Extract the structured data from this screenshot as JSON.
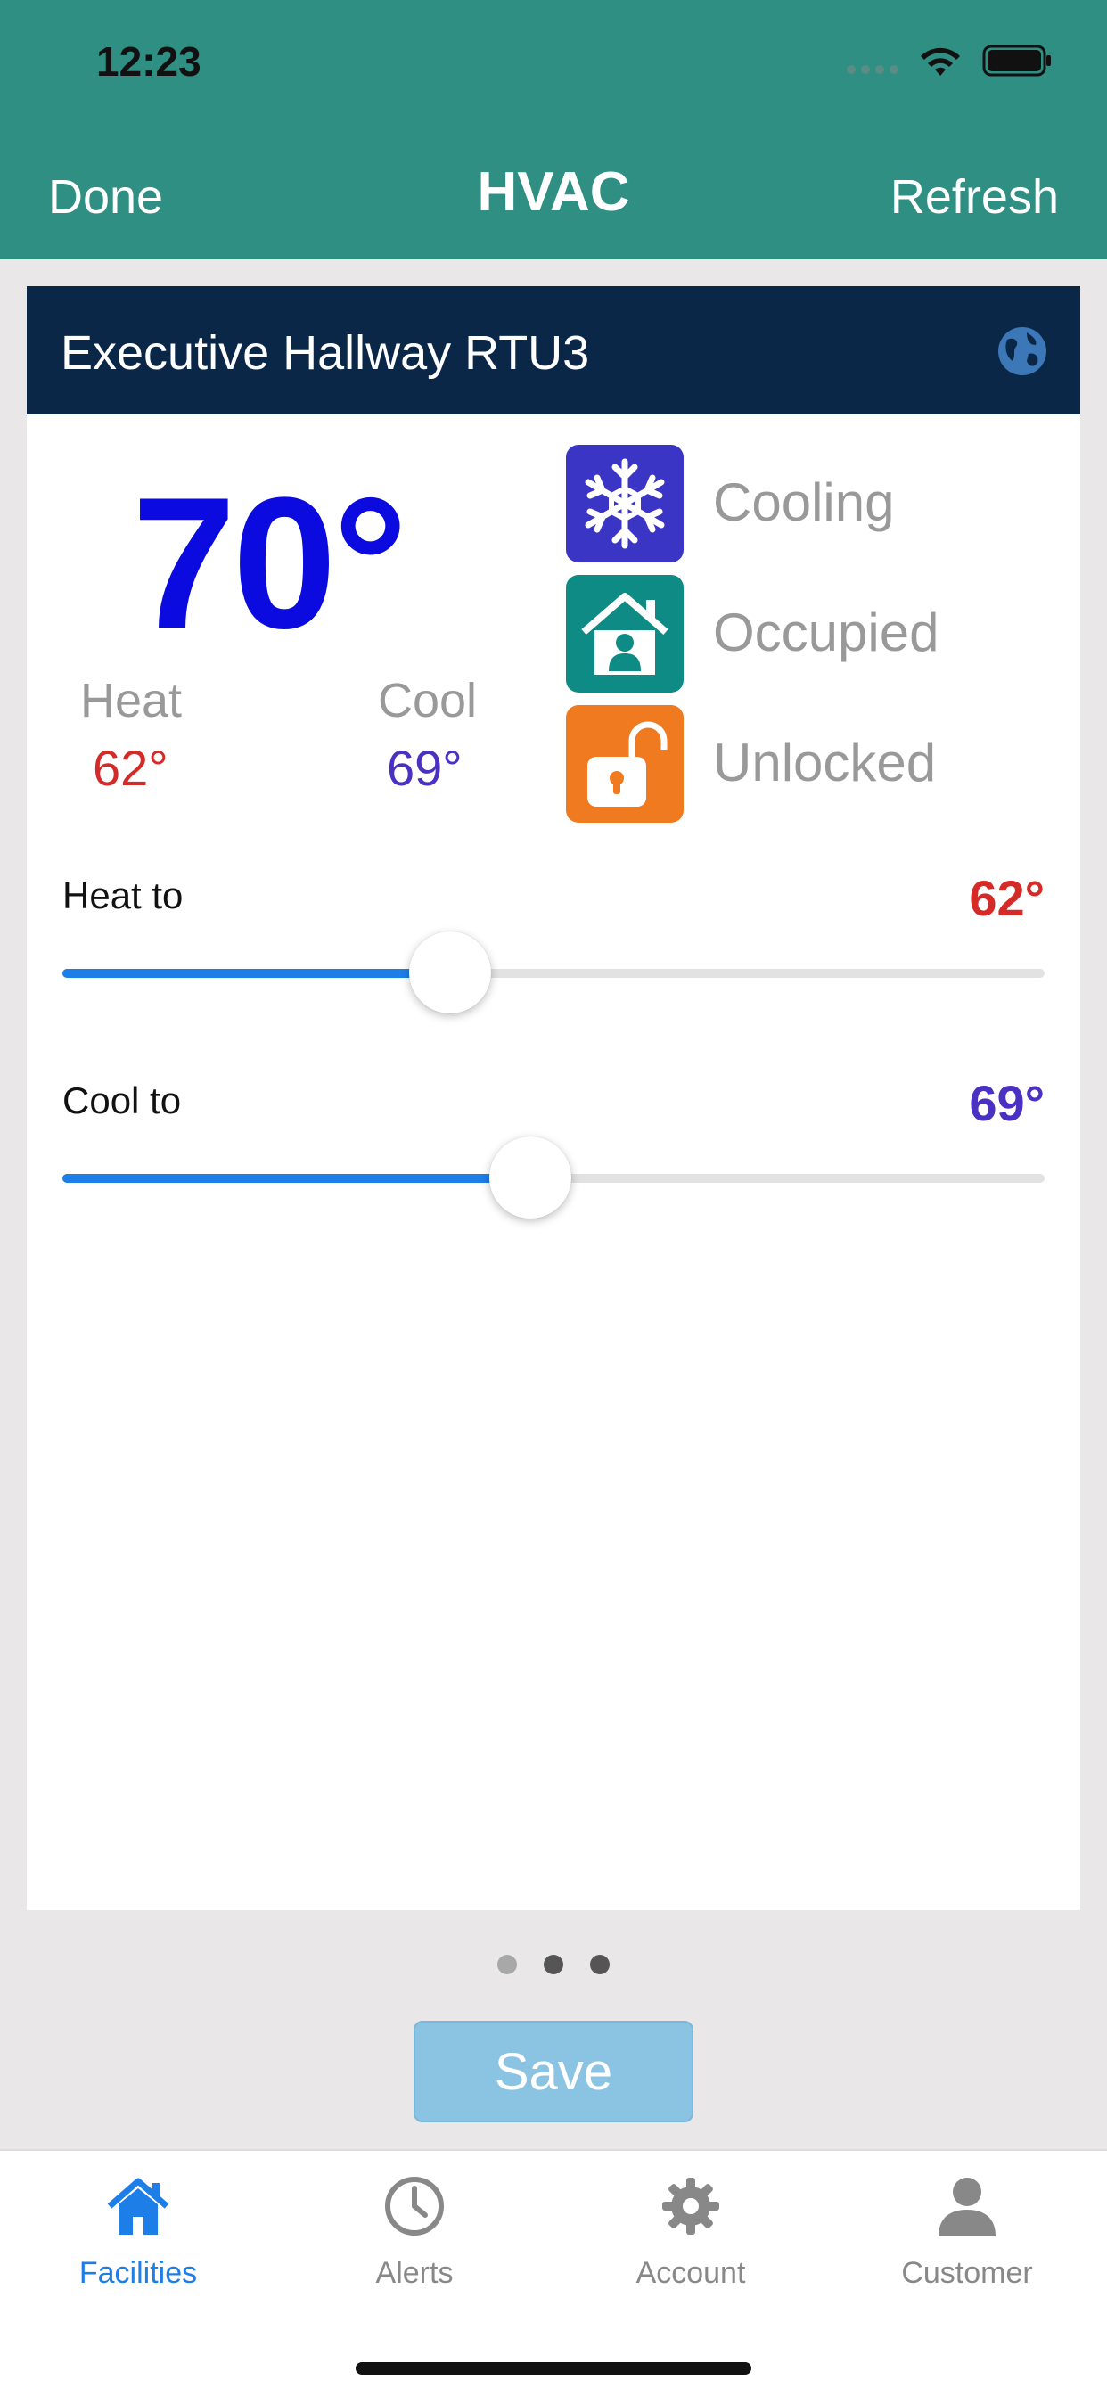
{
  "status_bar": {
    "time": "12:23"
  },
  "nav": {
    "left": "Done",
    "title": "HVAC",
    "right": "Refresh"
  },
  "card": {
    "title": "Executive Hallway RTU3",
    "current_temp": "70°",
    "heat_label": "Heat",
    "heat_value": "62°",
    "cool_label": "Cool",
    "cool_value": "69°",
    "statuses": [
      {
        "label": "Cooling",
        "icon": "snowflake-icon",
        "color": "#3b35c6"
      },
      {
        "label": "Occupied",
        "icon": "house-person-icon",
        "color": "#0e8b84"
      },
      {
        "label": "Unlocked",
        "icon": "unlocked-padlock-icon",
        "color": "#f07a20"
      }
    ],
    "heat_slider": {
      "label": "Heat to",
      "value": "62°",
      "fill_fraction": 0.395,
      "color": "#d52b28"
    },
    "cool_slider": {
      "label": "Cool to",
      "value": "69°",
      "fill_fraction": 0.476,
      "color": "#4b31c3"
    }
  },
  "pager": {
    "count": 3,
    "active_index": 0
  },
  "save_label": "Save",
  "tabs": [
    {
      "label": "Facilities",
      "icon": "home-icon",
      "active": true
    },
    {
      "label": "Alerts",
      "icon": "clock-icon",
      "active": false
    },
    {
      "label": "Account",
      "icon": "gear-icon",
      "active": false
    },
    {
      "label": "Customer",
      "icon": "person-icon",
      "active": false
    }
  ],
  "colors": {
    "header": "#2e8f82",
    "card_header": "#0a2748",
    "accent": "#1e7ee8",
    "active_tab": "#1e7ee8",
    "inactive_tab": "#888888"
  }
}
